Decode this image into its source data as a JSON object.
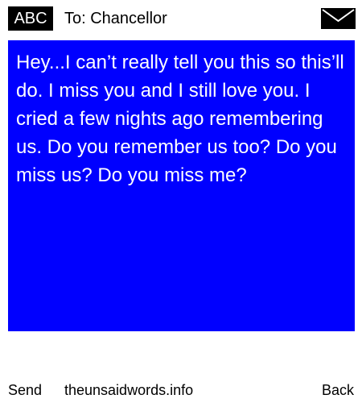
{
  "header": {
    "input_mode": "ABC",
    "recipient": "To: Chancellor",
    "envelope_icon": "envelope-icon"
  },
  "message": {
    "text": "Hey...I can’t really tell you this so this’ll do. I miss you and I still love you. I cried a few nights ago remembering us. Do you remember us too? Do you miss us? Do you miss me?",
    "background_color": "#0000ff",
    "text_color": "#ffffff"
  },
  "footer": {
    "left_softkey": "Send",
    "site": "theunsaidwords.info",
    "right_softkey": "Back"
  }
}
